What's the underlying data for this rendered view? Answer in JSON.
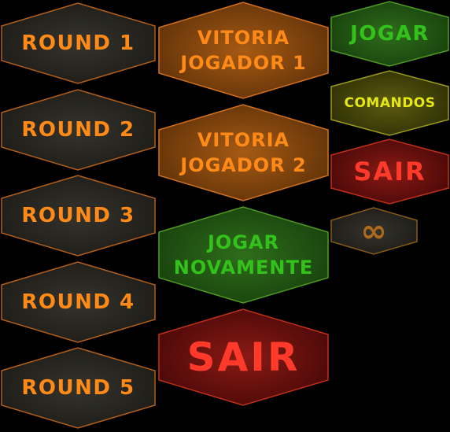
{
  "rounds": [
    "ROUND 1",
    "ROUND 2",
    "ROUND 3",
    "ROUND 4",
    "ROUND 5"
  ],
  "victory_p1": {
    "line1": "VITORIA",
    "line2": "JOGADOR 1"
  },
  "victory_p2": {
    "line1": "VITORIA",
    "line2": "JOGADOR 2"
  },
  "play_again": {
    "line1": "JOGAR",
    "line2": "NOVAMENTE"
  },
  "quit_large": "SAIR",
  "play": "JOGAR",
  "controls": "COMANDOS",
  "quit_small": "SAIR",
  "infinity_symbol": "∞",
  "colors": {
    "background": "#000000",
    "round_fill": "#2b2a24",
    "round_border": "#b35f1a",
    "orange_fill": "#8a4a10",
    "orange_border": "#d07020",
    "orange_text": "#ff8a18",
    "green_fill": "#245a16",
    "green_border": "#4f9a23",
    "green_text": "#33c21b",
    "olive_fill": "#4a4a0a",
    "olive_border": "#9a9a1a",
    "yellow_text": "#e6e813",
    "red_fill": "#6a1010",
    "red_border": "#c03018",
    "red_text": "#ff3a2a"
  }
}
